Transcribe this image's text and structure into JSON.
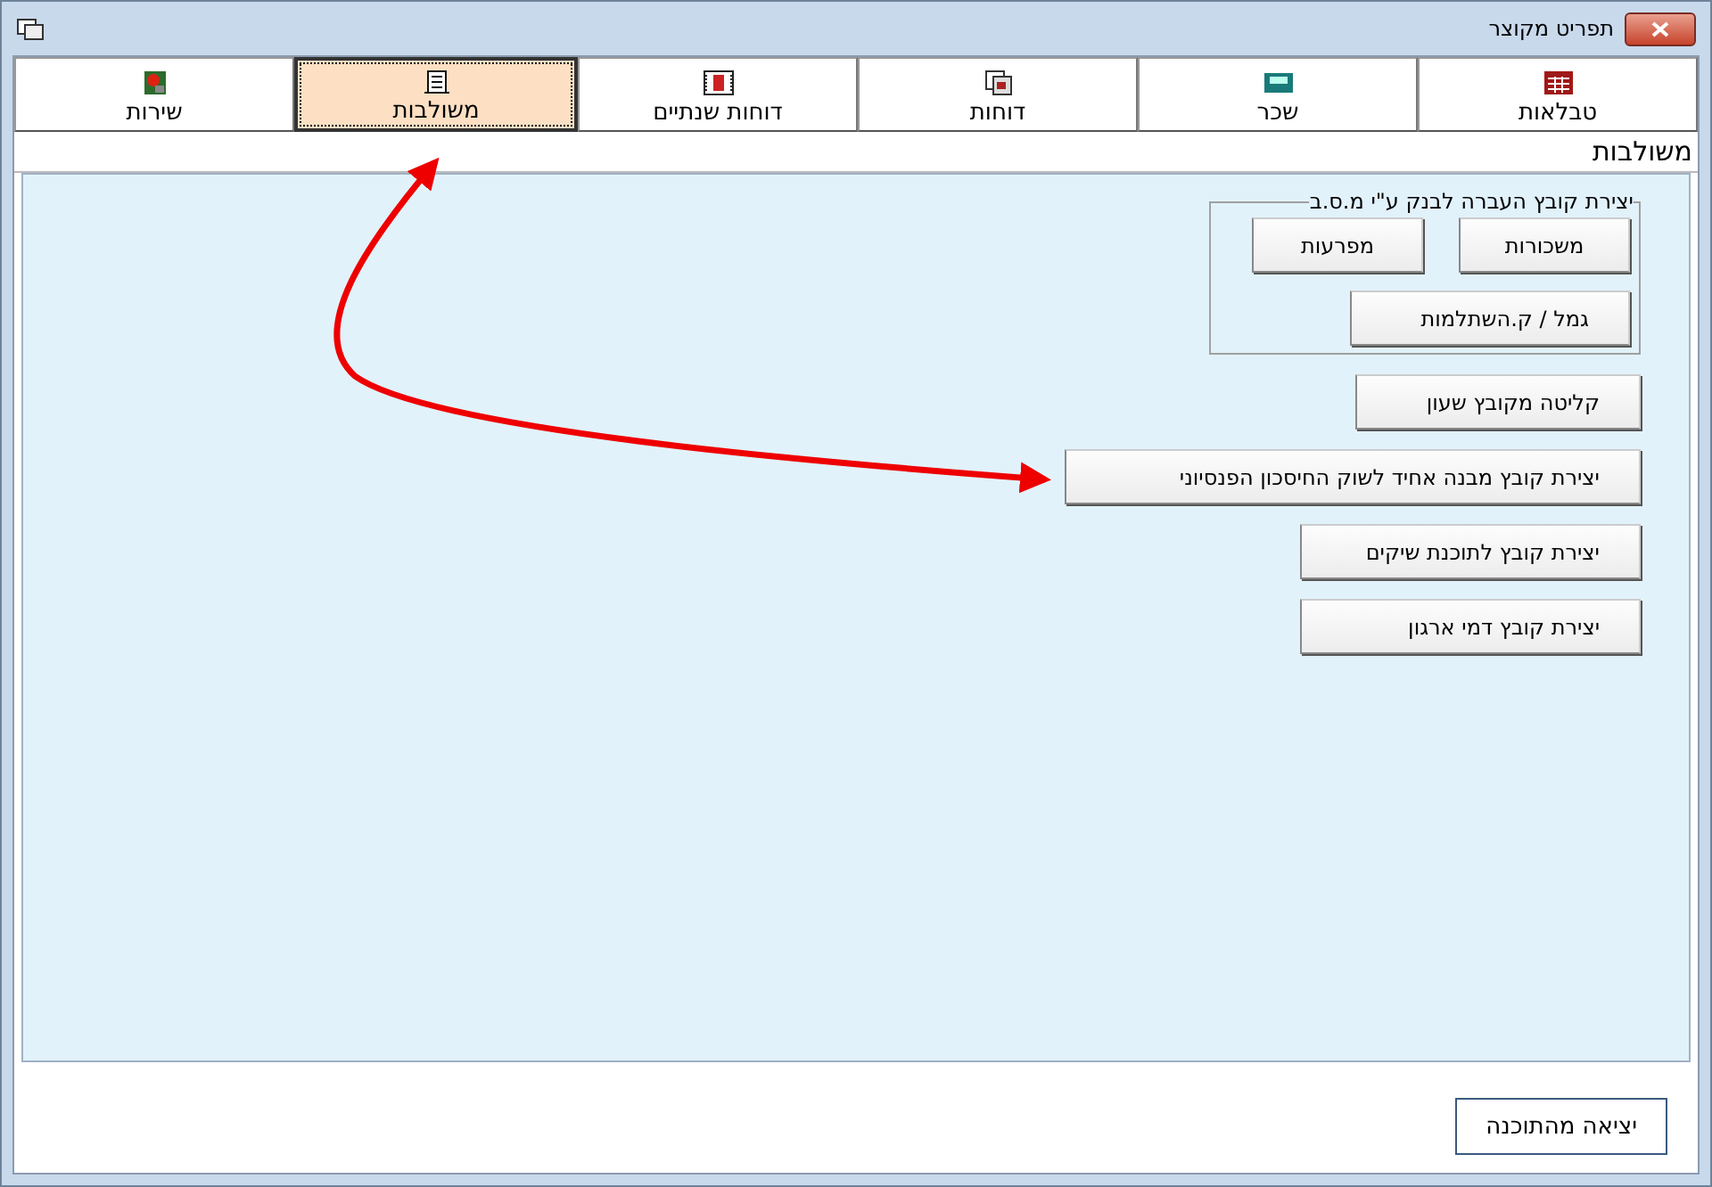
{
  "window": {
    "title": "תפריט מקוצר"
  },
  "tabs": [
    {
      "label": "טבלאות",
      "selected": false
    },
    {
      "label": "שכר",
      "selected": false
    },
    {
      "label": "דוחות",
      "selected": false
    },
    {
      "label": "דוחות שנתיים",
      "selected": false
    },
    {
      "label": "משולבות",
      "selected": true
    },
    {
      "label": "שירות",
      "selected": false
    }
  ],
  "section_title": "משולבות",
  "group": {
    "title": "יצירת קובץ העברה לבנק ע\"י מ.ס.ב",
    "buttons": [
      "משכורות",
      "מפרעות",
      "גמל / ק.השתלמות"
    ]
  },
  "buttons": [
    "קליטה מקובץ שעון",
    "יצירת קובץ מבנה אחיד לשוק החיסכון הפנסיוני",
    "יצירת קובץ לתוכנת שיקים",
    "יצירת קובץ דמי ארגון"
  ],
  "exit_button": "יציאה מהתוכנה"
}
